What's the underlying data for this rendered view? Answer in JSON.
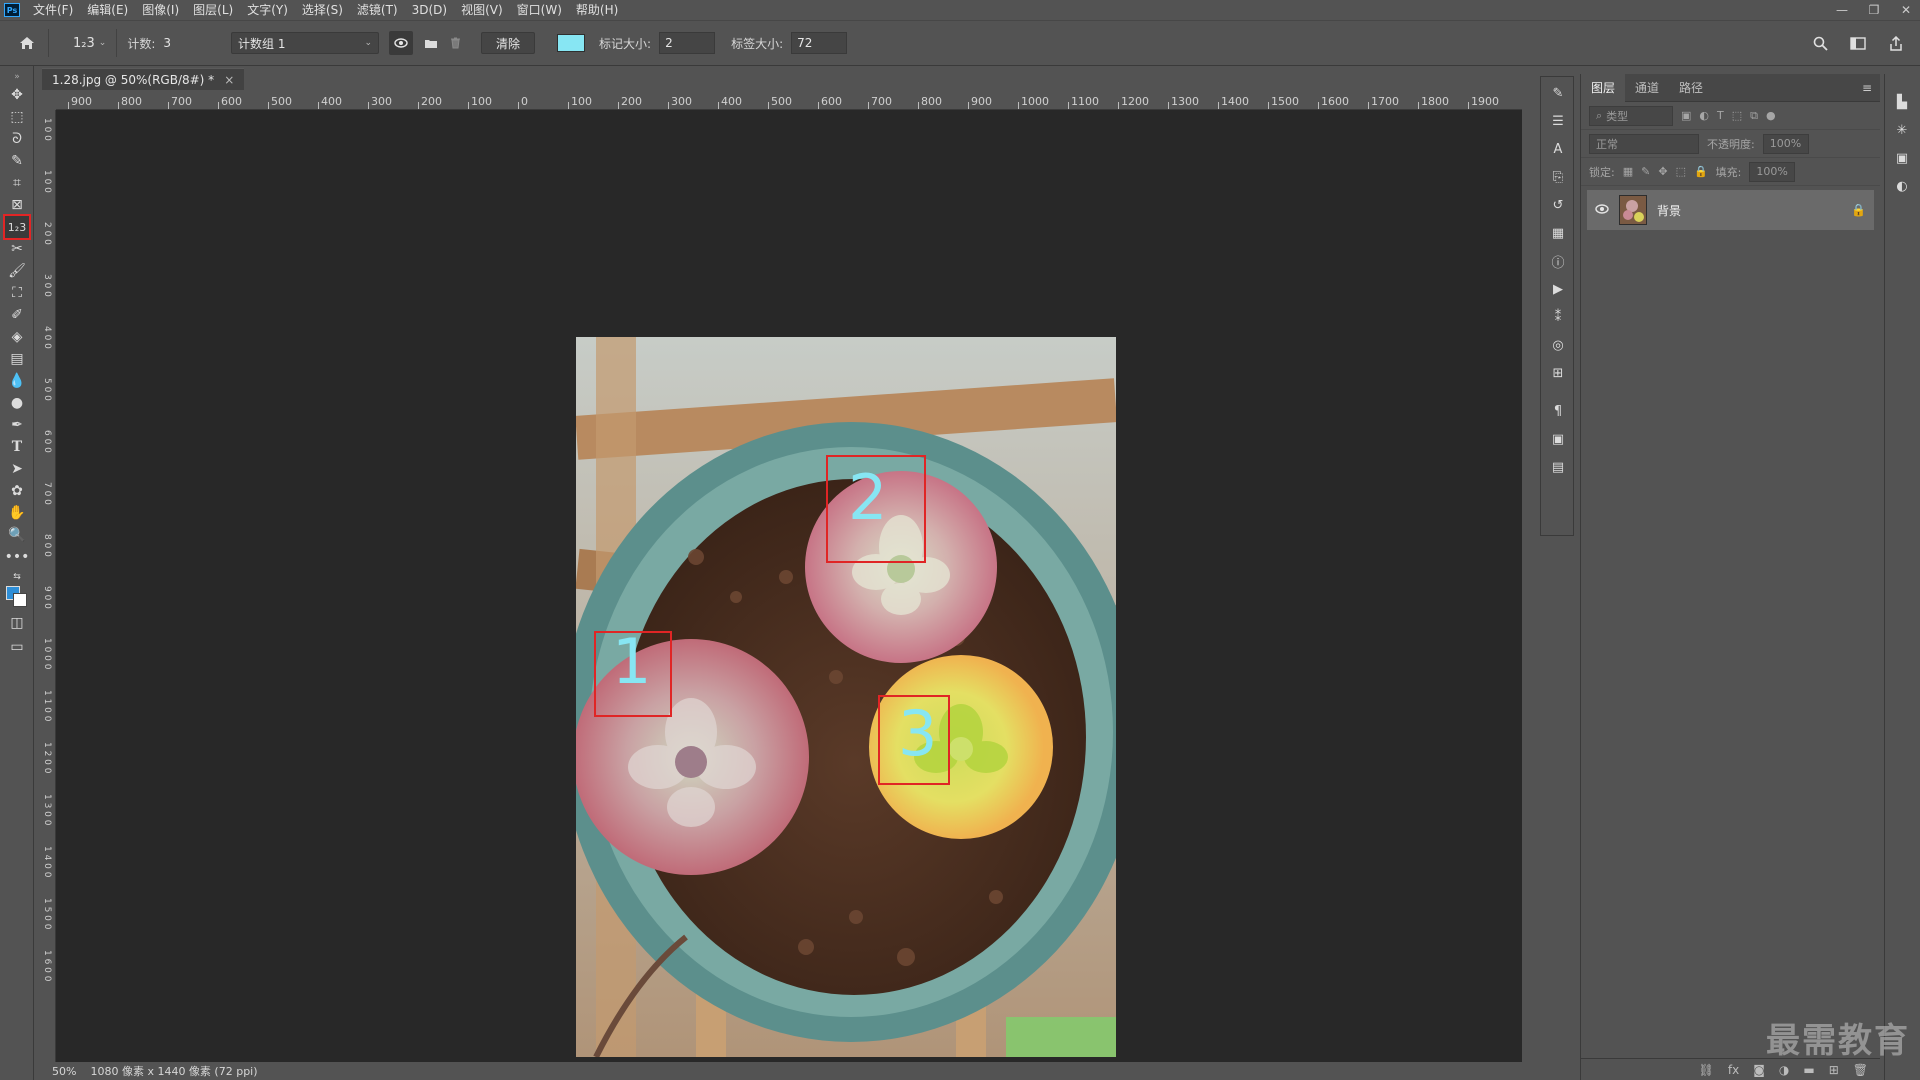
{
  "menubar": {
    "items": [
      "文件(F)",
      "编辑(E)",
      "图像(I)",
      "图层(L)",
      "文字(Y)",
      "选择(S)",
      "滤镜(T)",
      "3D(D)",
      "视图(V)",
      "窗口(W)",
      "帮助(H)"
    ],
    "logo": "Ps"
  },
  "options": {
    "tool_icon": "1₂3",
    "count_label": "计数:",
    "count_value": "3",
    "group_select": "计数组 1",
    "clear_label": "清除",
    "marker_size_label": "标记大小:",
    "marker_size_value": "2",
    "label_size_label": "标签大小:",
    "label_size_value": "72",
    "swatch_color": "#87e6f3"
  },
  "document": {
    "tab_title": "1.28.jpg @ 50%(RGB/8#) *",
    "close": "×"
  },
  "ruler": {
    "top_ticks": [
      "900",
      "800",
      "700",
      "600",
      "500",
      "400",
      "300",
      "200",
      "100",
      "0",
      "100",
      "200",
      "300",
      "400",
      "500",
      "600",
      "700",
      "800",
      "900",
      "1000",
      "1100",
      "1200",
      "1300",
      "1400",
      "1500",
      "1600",
      "1700",
      "1800",
      "1900"
    ],
    "left_ticks": [
      "1 0 0",
      "1 0 0",
      "2 0 0",
      "3 0 0",
      "4 0 0",
      "5 0 0",
      "6 0 0",
      "7 0 0",
      "8 0 0",
      "9 0 0",
      "1 0 0 0",
      "1 1 0 0",
      "1 2 0 0",
      "1 3 0 0",
      "1 4 0 0",
      "1 5 0 0",
      "1 6 0 0"
    ]
  },
  "counts": [
    {
      "label": "1"
    },
    {
      "label": "2"
    },
    {
      "label": "3"
    }
  ],
  "status": {
    "zoom": "50%",
    "info": "1080 像素 x 1440 像素 (72 ppi)"
  },
  "layers": {
    "tabs": [
      "图层",
      "通道",
      "路径"
    ],
    "filter_placeholder": "类型",
    "blend_mode": "正常",
    "opacity_label": "不透明度:",
    "opacity_value": "100%",
    "lock_label": "锁定:",
    "fill_label": "填充:",
    "fill_value": "100%",
    "layer_name": "背景"
  },
  "watermark": "最需教育"
}
